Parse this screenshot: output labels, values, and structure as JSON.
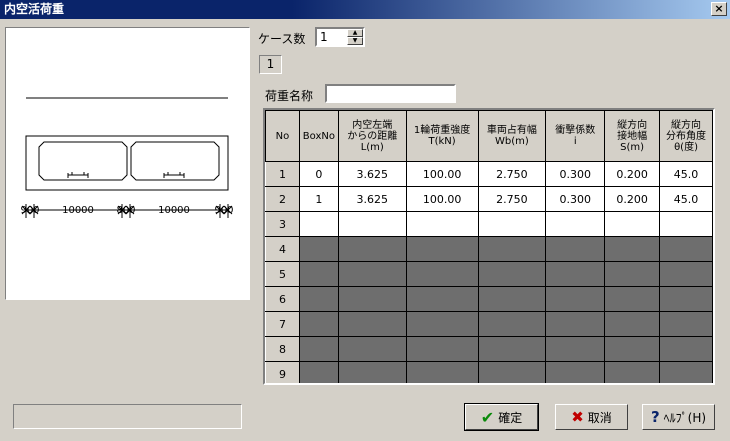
{
  "window": {
    "title": "内空活荷重",
    "close_glyph": "×"
  },
  "preview": {
    "dims": [
      "900",
      "10000",
      "800",
      "10000",
      "900"
    ]
  },
  "case_count": {
    "label": "ケース数",
    "value": "1"
  },
  "current_case": "1",
  "load_name": {
    "label": "荷重名称",
    "value": ""
  },
  "table": {
    "headers": [
      "No",
      "BoxNo",
      "内空左端からの距離L(m)",
      "1輪荷重強度T(kN)",
      "車両占有幅Wb(m)",
      "衝撃係数i",
      "縦方向接地幅S(m)",
      "縦方向分布角度θ(度)"
    ],
    "header_lines": [
      [
        "No"
      ],
      [
        "BoxNo"
      ],
      [
        "内空左端",
        "からの距離",
        "L(m)"
      ],
      [
        "1輪荷重強度",
        "T(kN)"
      ],
      [
        "車両占有幅",
        "Wb(m)"
      ],
      [
        "衝撃係数",
        "i"
      ],
      [
        "縦方向",
        "接地幅",
        "S(m)"
      ],
      [
        "縦方向",
        "分布角度",
        "θ(度)"
      ]
    ],
    "rows": [
      [
        "1",
        "0",
        "3.625",
        "100.00",
        "2.750",
        "0.300",
        "0.200",
        "45.0"
      ],
      [
        "2",
        "1",
        "3.625",
        "100.00",
        "2.750",
        "0.300",
        "0.200",
        "45.0"
      ],
      [
        "3",
        "",
        "",
        "",
        "",
        "",
        "",
        ""
      ],
      [
        "4",
        "",
        "",
        "",
        "",
        "",
        "",
        ""
      ],
      [
        "5",
        "",
        "",
        "",
        "",
        "",
        "",
        ""
      ],
      [
        "6",
        "",
        "",
        "",
        "",
        "",
        "",
        ""
      ],
      [
        "7",
        "",
        "",
        "",
        "",
        "",
        "",
        ""
      ],
      [
        "8",
        "",
        "",
        "",
        "",
        "",
        "",
        ""
      ],
      [
        "9",
        "",
        "",
        "",
        "",
        "",
        "",
        ""
      ]
    ],
    "active_rows": 3
  },
  "buttons": {
    "ok": "確定",
    "cancel": "取消",
    "help": "ﾍﾙﾌﾟ(H)"
  },
  "colors": {
    "ok_icon": "#0a8a0a",
    "cancel_icon": "#c00000",
    "help_icon": "#0a246a",
    "disabled_cell": "#6e6e6e"
  }
}
